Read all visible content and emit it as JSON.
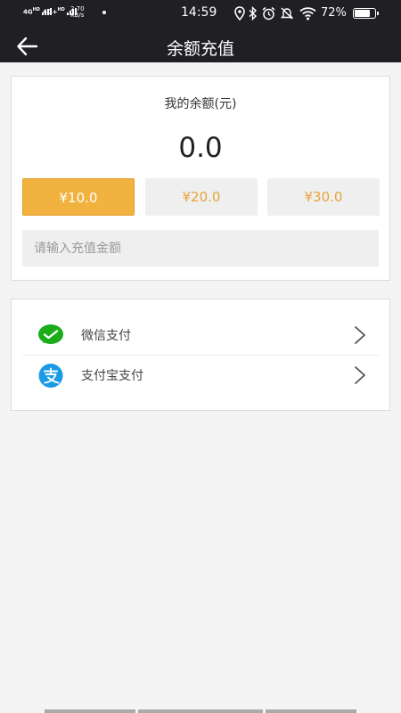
{
  "status": {
    "network1": "4G",
    "network1_sup": "HD",
    "network2": "4G+",
    "network2_sup": "HD",
    "speed_value": "2.70",
    "speed_unit": "KB/s",
    "time": "14:59",
    "battery_pct": "72%",
    "battery_level": 0.72,
    "icons": [
      "location-icon",
      "bluetooth-icon",
      "alarm-icon",
      "mute-icon",
      "wifi-icon",
      "battery-icon"
    ]
  },
  "header": {
    "title": "余额充值"
  },
  "balance": {
    "label": "我的余额(元)",
    "value": "0.0"
  },
  "amounts": [
    {
      "label": "¥10.0",
      "selected": true
    },
    {
      "label": "¥20.0",
      "selected": false
    },
    {
      "label": "¥30.0",
      "selected": false
    }
  ],
  "recharge_input": {
    "placeholder": "请输入充值金额",
    "value": ""
  },
  "payment_methods": [
    {
      "label": "微信支付",
      "icon": "wechat-pay-icon"
    },
    {
      "label": "支付宝支付",
      "icon": "alipay-icon"
    }
  ],
  "colors": {
    "header_bg": "#1f1f24",
    "accent": "#f2b23f",
    "wechat_green": "#1aad19",
    "alipay_blue": "#1a9be6"
  }
}
